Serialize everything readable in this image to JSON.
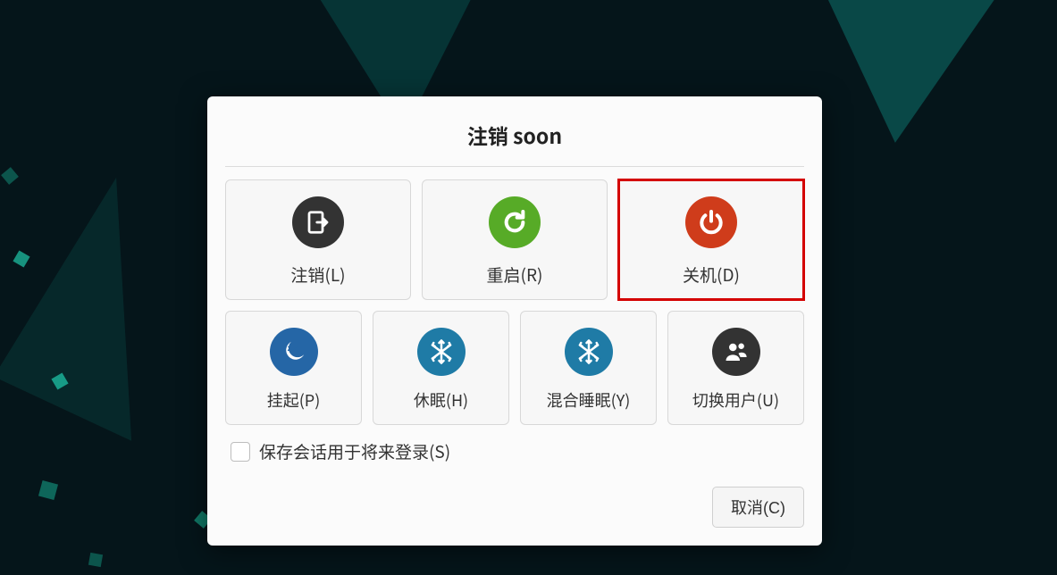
{
  "dialog": {
    "title": "注销 soon",
    "row1": [
      {
        "id": "logout",
        "label": "注销(L)",
        "icon": "logout-icon",
        "color": "c-dark",
        "highlight": false
      },
      {
        "id": "restart",
        "label": "重启(R)",
        "icon": "restart-icon",
        "color": "c-green",
        "highlight": false
      },
      {
        "id": "shutdown",
        "label": "关机(D)",
        "icon": "power-icon",
        "color": "c-red",
        "highlight": true
      }
    ],
    "row2": [
      {
        "id": "suspend",
        "label": "挂起(P)",
        "icon": "moon-icon",
        "color": "c-night",
        "highlight": false
      },
      {
        "id": "hibernate",
        "label": "休眠(H)",
        "icon": "snowflake-icon",
        "color": "c-blue",
        "highlight": false
      },
      {
        "id": "hybrid-sleep",
        "label": "混合睡眠(Y)",
        "icon": "snowflake-icon",
        "color": "c-blue",
        "highlight": false
      },
      {
        "id": "switch-user",
        "label": "切换用户(U)",
        "icon": "users-icon",
        "color": "c-dark",
        "highlight": false
      }
    ],
    "checkbox": {
      "label": "保存会话用于将来登录(S)",
      "checked": false
    },
    "cancel": "取消(C)"
  }
}
